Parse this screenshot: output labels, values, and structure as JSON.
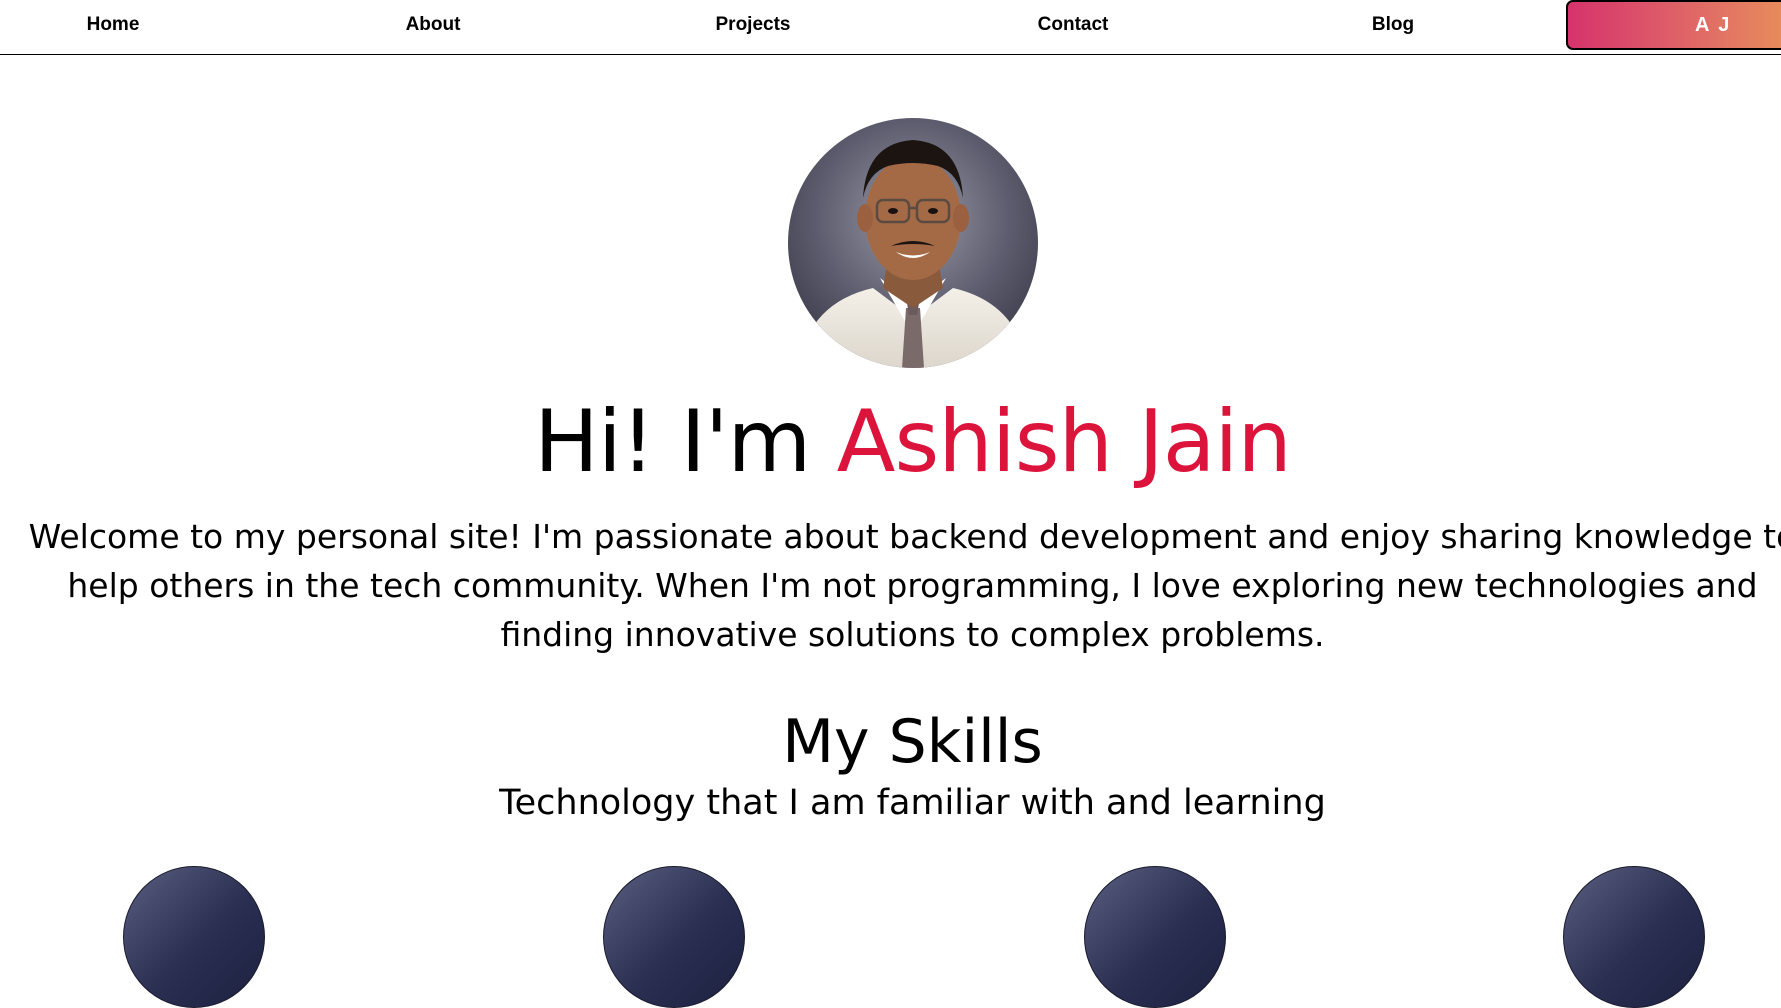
{
  "nav": {
    "items": [
      {
        "label": "Home"
      },
      {
        "label": "About"
      },
      {
        "label": "Projects"
      },
      {
        "label": "Contact"
      },
      {
        "label": "Blog"
      }
    ],
    "brand": "A J"
  },
  "hero": {
    "greeting_prefix": "Hi! I'm ",
    "name": "Ashish Jain",
    "intro_lines": [
      "Welcome to my personal site! I'm passionate about backend development and enjoy sharing knowledge to",
      "help others in the tech community. When I'm not programming, I love exploring new technologies and",
      "finding innovative solutions to complex problems."
    ]
  },
  "skills": {
    "title": "My Skills",
    "subtitle": "Technology that I am familiar with and learning"
  },
  "colors": {
    "accent": "#dc143c",
    "brand_gradient_start": "#d6336c",
    "brand_gradient_end": "#e8905a",
    "skill_circle": "#2a2f52"
  }
}
